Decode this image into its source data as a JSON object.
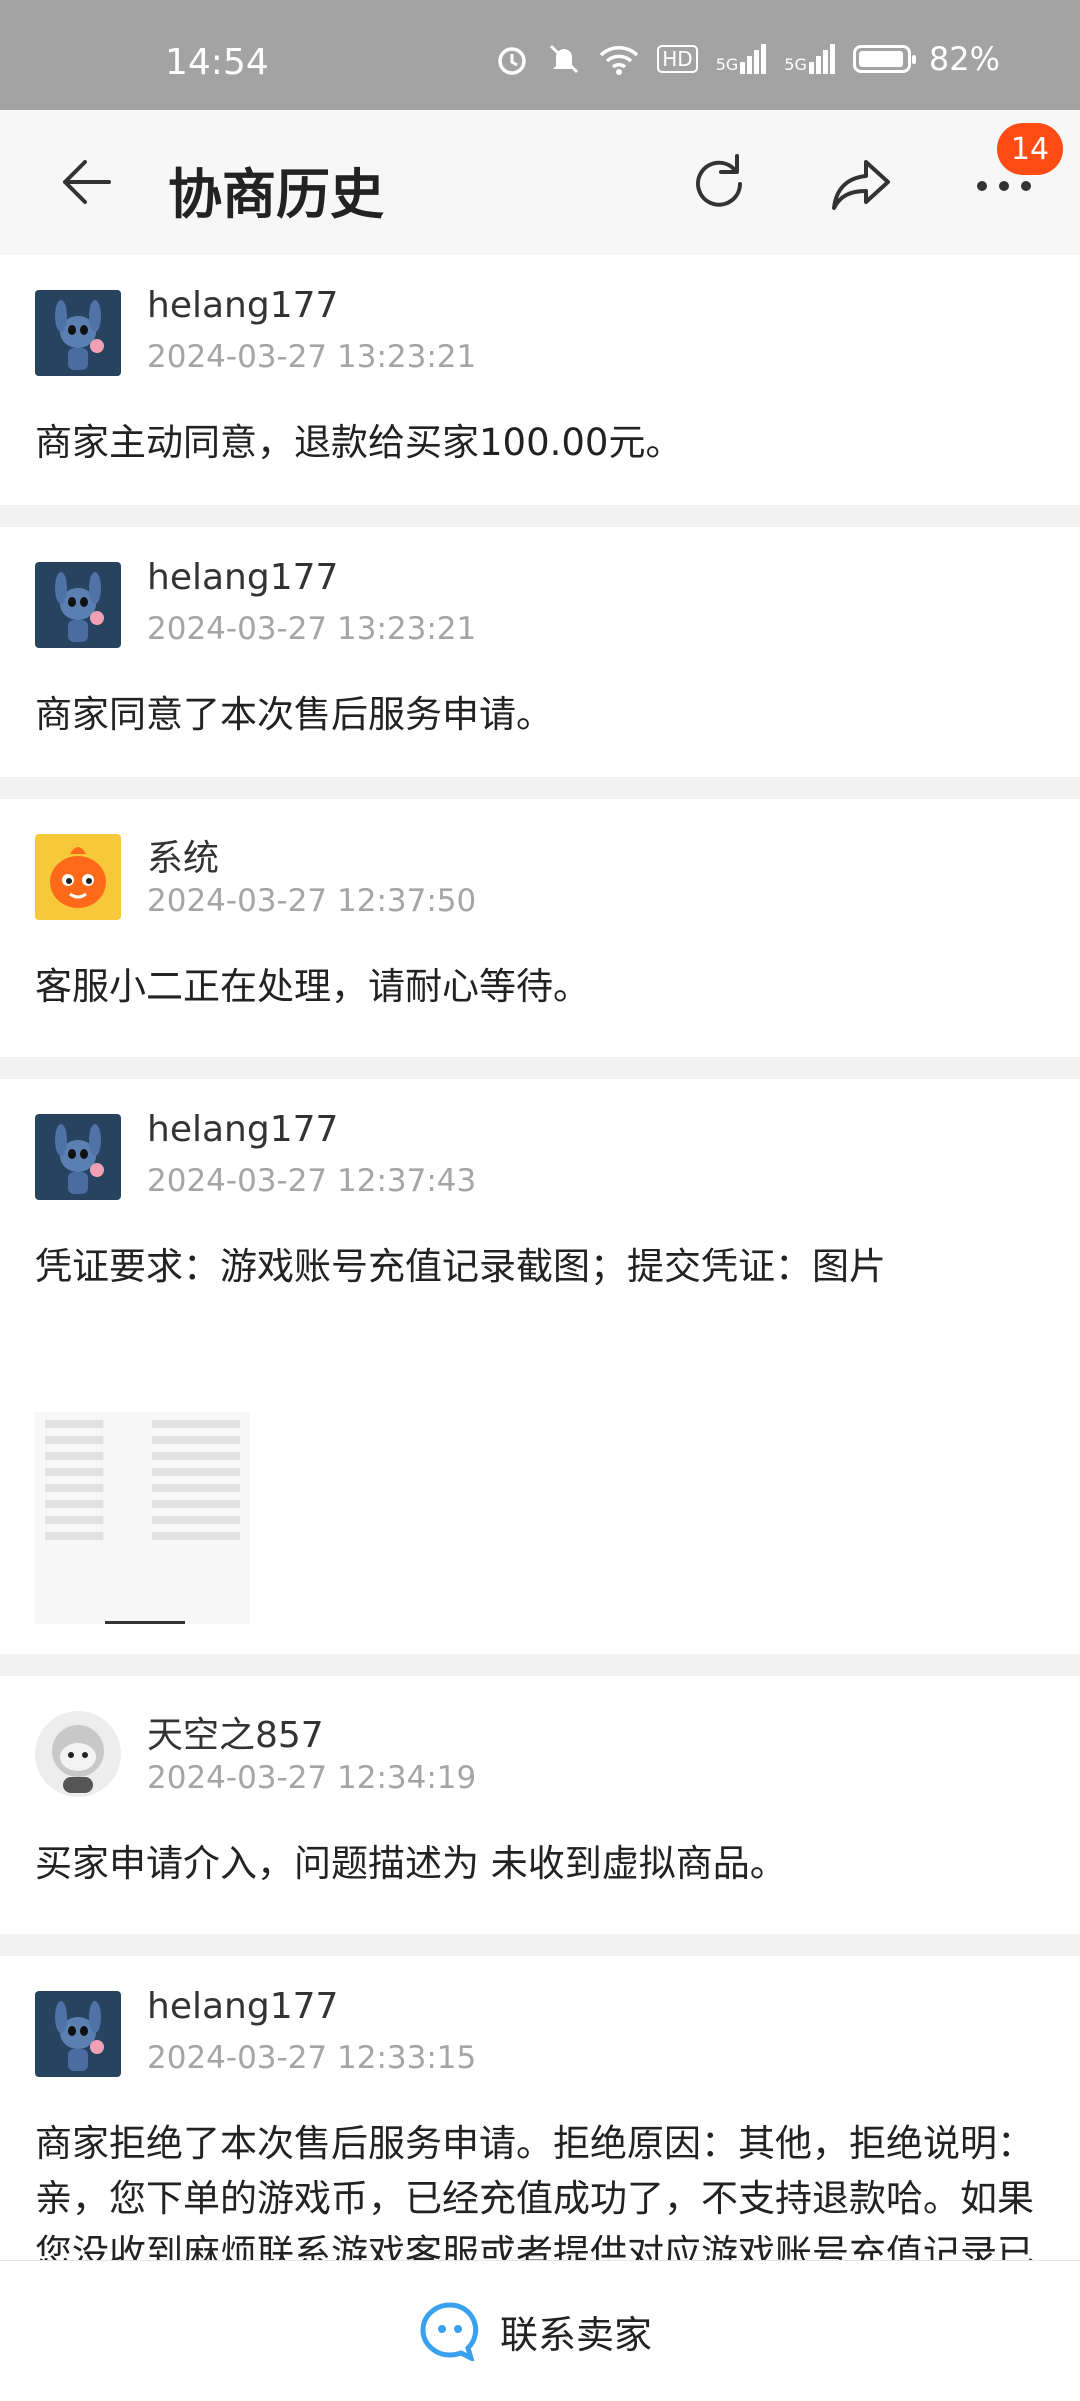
{
  "status_bar": {
    "time": "14:54",
    "network": "HD",
    "signal1": "5G",
    "signal2": "5G",
    "battery": "82%"
  },
  "header": {
    "title": "协商历史",
    "badge": "14"
  },
  "entries": [
    {
      "name": "helang177",
      "time": "2024-03-27 13:23:21",
      "message": "商家主动同意，退款给买家100.00元。",
      "avatar": "stitch"
    },
    {
      "name": "helang177",
      "time": "2024-03-27 13:23:21",
      "message": "商家同意了本次售后服务申请。",
      "avatar": "stitch"
    },
    {
      "name": "系统",
      "time": "2024-03-27 12:37:50",
      "message": "客服小二正在处理，请耐心等待。",
      "avatar": "system-mascot"
    },
    {
      "name": "helang177",
      "time": "2024-03-27 12:37:43",
      "message": "凭证要求：游戏账号充值记录截图；提交凭证：图片",
      "avatar": "stitch"
    },
    {
      "name": "天空之857",
      "time": "2024-03-27 12:34:19",
      "message": "买家申请介入，问题描述为 未收到虚拟商品。",
      "avatar": "gray-doll"
    },
    {
      "name": "helang177",
      "time": "2024-03-27 12:33:15",
      "message": "商家拒绝了本次售后服务申请。拒绝原因：其他，拒绝说明：亲，您下单的游戏币，已经充值成功了，不支持退款哈。如果您没收到麻烦联系游戏客服或者提供对应游戏账号充值记录已",
      "avatar": "stitch"
    }
  ],
  "footer": {
    "contact_label": "联系卖家"
  },
  "colors": {
    "accent": "#ff4b14",
    "header_bg": "#f7f7f7",
    "status_bg": "#a3a3a3",
    "contact_icon": "#3aa0f0"
  }
}
